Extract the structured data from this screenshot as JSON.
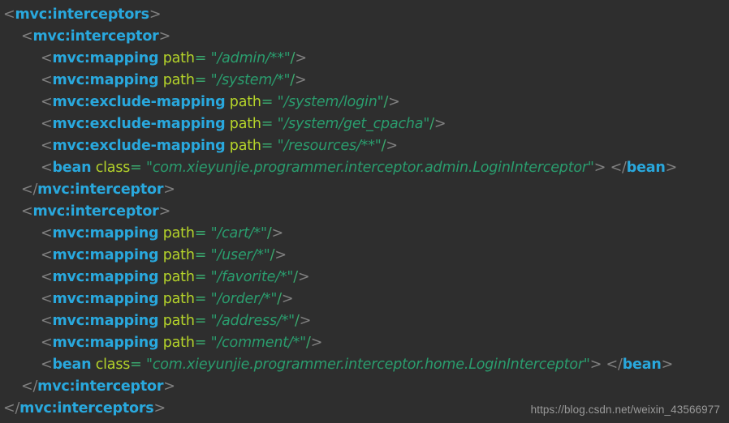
{
  "editor": {
    "background_color": "#2e2e2e",
    "language": "xml",
    "theme_colors": {
      "punctuation": "#808080",
      "tag_name": "#29a8dd",
      "attribute_name": "#b5d42a",
      "equals": "#3aa86e",
      "string_value": "#2a9d6e",
      "watermark": "#9a9a9a"
    }
  },
  "watermark": {
    "text": "https://blog.csdn.net/weixin_43566977"
  },
  "code": {
    "lines": [
      {
        "indent": 0,
        "tokens": [
          {
            "type": "punct",
            "text": "<"
          },
          {
            "type": "tag",
            "text": "mvc:interceptors"
          },
          {
            "type": "punct",
            "text": ">"
          }
        ]
      },
      {
        "indent": 1,
        "tokens": [
          {
            "type": "punct",
            "text": "<"
          },
          {
            "type": "tag",
            "text": "mvc:interceptor"
          },
          {
            "type": "punct",
            "text": ">"
          }
        ]
      },
      {
        "indent": 2,
        "tokens": [
          {
            "type": "punct",
            "text": "<"
          },
          {
            "type": "tag",
            "text": "mvc:mapping"
          },
          {
            "type": "space",
            "text": " "
          },
          {
            "type": "attr",
            "text": "path"
          },
          {
            "type": "eq",
            "text": "="
          },
          {
            "type": "space",
            "text": " "
          },
          {
            "type": "string",
            "text": "\"/admin/**\""
          },
          {
            "type": "eq",
            "text": "/"
          },
          {
            "type": "punct",
            "text": ">"
          }
        ]
      },
      {
        "indent": 2,
        "tokens": [
          {
            "type": "punct",
            "text": "<"
          },
          {
            "type": "tag",
            "text": "mvc:mapping"
          },
          {
            "type": "space",
            "text": " "
          },
          {
            "type": "attr",
            "text": "path"
          },
          {
            "type": "eq",
            "text": "="
          },
          {
            "type": "space",
            "text": " "
          },
          {
            "type": "string",
            "text": "\"/system/*\""
          },
          {
            "type": "eq",
            "text": "/"
          },
          {
            "type": "punct",
            "text": ">"
          }
        ]
      },
      {
        "indent": 2,
        "tokens": [
          {
            "type": "punct",
            "text": "<"
          },
          {
            "type": "tag",
            "text": "mvc:exclude-mapping"
          },
          {
            "type": "space",
            "text": " "
          },
          {
            "type": "attr",
            "text": "path"
          },
          {
            "type": "eq",
            "text": "="
          },
          {
            "type": "space",
            "text": " "
          },
          {
            "type": "string",
            "text": "\"/system/login\""
          },
          {
            "type": "eq",
            "text": "/"
          },
          {
            "type": "punct",
            "text": ">"
          }
        ]
      },
      {
        "indent": 2,
        "tokens": [
          {
            "type": "punct",
            "text": "<"
          },
          {
            "type": "tag",
            "text": "mvc:exclude-mapping"
          },
          {
            "type": "space",
            "text": " "
          },
          {
            "type": "attr",
            "text": "path"
          },
          {
            "type": "eq",
            "text": "="
          },
          {
            "type": "space",
            "text": " "
          },
          {
            "type": "string",
            "text": "\"/system/get_cpacha\""
          },
          {
            "type": "eq",
            "text": "/"
          },
          {
            "type": "punct",
            "text": ">"
          }
        ]
      },
      {
        "indent": 2,
        "tokens": [
          {
            "type": "punct",
            "text": "<"
          },
          {
            "type": "tag",
            "text": "mvc:exclude-mapping"
          },
          {
            "type": "space",
            "text": " "
          },
          {
            "type": "attr",
            "text": "path"
          },
          {
            "type": "eq",
            "text": "="
          },
          {
            "type": "space",
            "text": " "
          },
          {
            "type": "string",
            "text": "\"/resources/**\""
          },
          {
            "type": "eq",
            "text": "/"
          },
          {
            "type": "punct",
            "text": ">"
          }
        ]
      },
      {
        "indent": 2,
        "tokens": [
          {
            "type": "punct",
            "text": "<"
          },
          {
            "type": "tag",
            "text": "bean"
          },
          {
            "type": "space",
            "text": " "
          },
          {
            "type": "attr",
            "text": "class"
          },
          {
            "type": "eq",
            "text": "="
          },
          {
            "type": "space",
            "text": " "
          },
          {
            "type": "string",
            "text": "\"com.xieyunjie.programmer.interceptor.admin.LoginInterceptor\""
          },
          {
            "type": "punct",
            "text": ">"
          },
          {
            "type": "space",
            "text": " "
          },
          {
            "type": "punct",
            "text": "</"
          },
          {
            "type": "tag",
            "text": "bean"
          },
          {
            "type": "punct",
            "text": ">"
          }
        ]
      },
      {
        "indent": 1,
        "tokens": [
          {
            "type": "punct",
            "text": "</"
          },
          {
            "type": "tag",
            "text": "mvc:interceptor"
          },
          {
            "type": "punct",
            "text": ">"
          }
        ]
      },
      {
        "indent": 1,
        "tokens": [
          {
            "type": "punct",
            "text": "<"
          },
          {
            "type": "tag",
            "text": "mvc:interceptor"
          },
          {
            "type": "punct",
            "text": ">"
          }
        ]
      },
      {
        "indent": 2,
        "tokens": [
          {
            "type": "punct",
            "text": "<"
          },
          {
            "type": "tag",
            "text": "mvc:mapping"
          },
          {
            "type": "space",
            "text": " "
          },
          {
            "type": "attr",
            "text": "path"
          },
          {
            "type": "eq",
            "text": "="
          },
          {
            "type": "space",
            "text": " "
          },
          {
            "type": "string",
            "text": "\"/cart/*\""
          },
          {
            "type": "eq",
            "text": "/"
          },
          {
            "type": "punct",
            "text": ">"
          }
        ]
      },
      {
        "indent": 2,
        "tokens": [
          {
            "type": "punct",
            "text": "<"
          },
          {
            "type": "tag",
            "text": "mvc:mapping"
          },
          {
            "type": "space",
            "text": " "
          },
          {
            "type": "attr",
            "text": "path"
          },
          {
            "type": "eq",
            "text": "="
          },
          {
            "type": "space",
            "text": " "
          },
          {
            "type": "string",
            "text": "\"/user/*\""
          },
          {
            "type": "eq",
            "text": "/"
          },
          {
            "type": "punct",
            "text": ">"
          }
        ]
      },
      {
        "indent": 2,
        "tokens": [
          {
            "type": "punct",
            "text": "<"
          },
          {
            "type": "tag",
            "text": "mvc:mapping"
          },
          {
            "type": "space",
            "text": " "
          },
          {
            "type": "attr",
            "text": "path"
          },
          {
            "type": "eq",
            "text": "="
          },
          {
            "type": "space",
            "text": " "
          },
          {
            "type": "string",
            "text": "\"/favorite/*\""
          },
          {
            "type": "eq",
            "text": "/"
          },
          {
            "type": "punct",
            "text": ">"
          }
        ]
      },
      {
        "indent": 2,
        "tokens": [
          {
            "type": "punct",
            "text": "<"
          },
          {
            "type": "tag",
            "text": "mvc:mapping"
          },
          {
            "type": "space",
            "text": " "
          },
          {
            "type": "attr",
            "text": "path"
          },
          {
            "type": "eq",
            "text": "="
          },
          {
            "type": "space",
            "text": " "
          },
          {
            "type": "string",
            "text": "\"/order/*\""
          },
          {
            "type": "eq",
            "text": "/"
          },
          {
            "type": "punct",
            "text": ">"
          }
        ]
      },
      {
        "indent": 2,
        "tokens": [
          {
            "type": "punct",
            "text": "<"
          },
          {
            "type": "tag",
            "text": "mvc:mapping"
          },
          {
            "type": "space",
            "text": " "
          },
          {
            "type": "attr",
            "text": "path"
          },
          {
            "type": "eq",
            "text": "="
          },
          {
            "type": "space",
            "text": " "
          },
          {
            "type": "string",
            "text": "\"/address/*\""
          },
          {
            "type": "eq",
            "text": "/"
          },
          {
            "type": "punct",
            "text": ">"
          }
        ]
      },
      {
        "indent": 2,
        "tokens": [
          {
            "type": "punct",
            "text": "<"
          },
          {
            "type": "tag",
            "text": "mvc:mapping"
          },
          {
            "type": "space",
            "text": " "
          },
          {
            "type": "attr",
            "text": "path"
          },
          {
            "type": "eq",
            "text": "="
          },
          {
            "type": "space",
            "text": " "
          },
          {
            "type": "string",
            "text": "\"/comment/*\""
          },
          {
            "type": "eq",
            "text": "/"
          },
          {
            "type": "punct",
            "text": ">"
          }
        ]
      },
      {
        "indent": 2,
        "tokens": [
          {
            "type": "punct",
            "text": "<"
          },
          {
            "type": "tag",
            "text": "bean"
          },
          {
            "type": "space",
            "text": " "
          },
          {
            "type": "attr",
            "text": "class"
          },
          {
            "type": "eq",
            "text": "="
          },
          {
            "type": "space",
            "text": " "
          },
          {
            "type": "string",
            "text": "\"com.xieyunjie.programmer.interceptor.home.LoginInterceptor\""
          },
          {
            "type": "punct",
            "text": ">"
          },
          {
            "type": "space",
            "text": " "
          },
          {
            "type": "punct",
            "text": "</"
          },
          {
            "type": "tag",
            "text": "bean"
          },
          {
            "type": "punct",
            "text": ">"
          }
        ]
      },
      {
        "indent": 1,
        "tokens": [
          {
            "type": "punct",
            "text": "</"
          },
          {
            "type": "tag",
            "text": "mvc:interceptor"
          },
          {
            "type": "punct",
            "text": ">"
          }
        ]
      },
      {
        "indent": 0,
        "tokens": [
          {
            "type": "punct",
            "text": "</"
          },
          {
            "type": "tag",
            "text": "mvc:interceptors"
          },
          {
            "type": "punct",
            "text": ">"
          }
        ]
      }
    ]
  }
}
